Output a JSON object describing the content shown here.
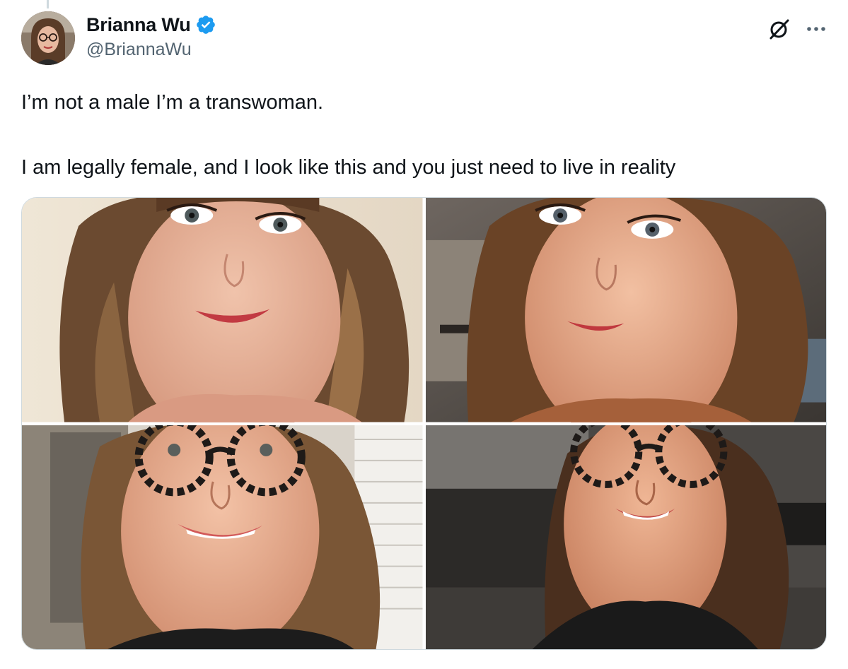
{
  "author": {
    "display_name": "Brianna Wu",
    "handle": "@BriannaWu",
    "verified": true,
    "verified_color": "#1d9bf0"
  },
  "icons": {
    "verified": "verified-badge-icon",
    "grok": "grok-icon",
    "more": "more-options-icon"
  },
  "tweet": {
    "paragraphs": [
      "I’m not a male I’m a transwoman.",
      "I am legally female, and I look like this and you just need to live in reality"
    ]
  },
  "media": {
    "photos": [
      {
        "name": "selfie-1"
      },
      {
        "name": "selfie-2"
      },
      {
        "name": "selfie-3-glasses"
      },
      {
        "name": "selfie-4-glasses"
      }
    ]
  },
  "colors": {
    "text": "#0f1419",
    "secondary": "#536471",
    "border": "#cfd9de"
  }
}
